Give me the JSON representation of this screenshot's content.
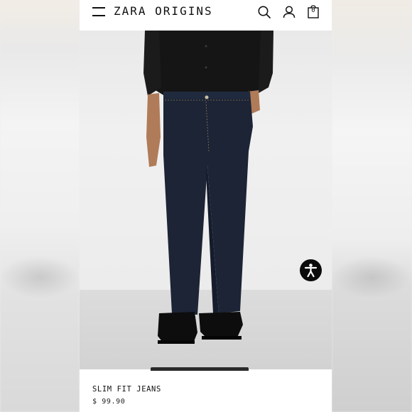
{
  "header": {
    "brand": "ZARA ORIGINS",
    "bag_count": "0"
  },
  "product": {
    "name": "SLIM FIT JEANS",
    "price": "$ 99.90"
  },
  "icons": {
    "menu": "hamburger-menu-icon",
    "search": "search-icon",
    "account": "account-icon",
    "bag": "shopping-bag-icon",
    "accessibility": "accessibility-icon"
  },
  "colors": {
    "accent": "#111111",
    "background": "#ffffff",
    "accessibility_button": "#0b0b0b",
    "jeans": "#1c2436",
    "shirt": "#161616"
  }
}
